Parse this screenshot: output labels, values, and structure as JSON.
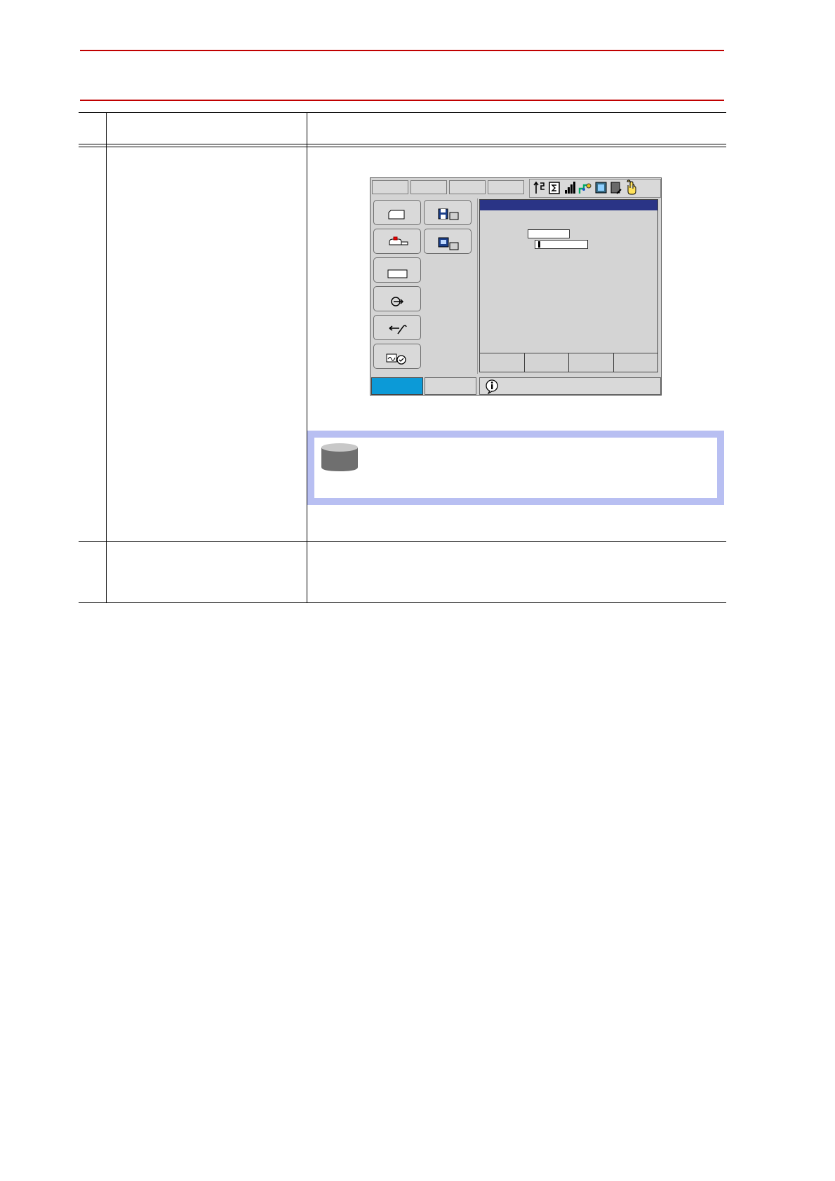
{
  "page": {
    "header_rule_color": "#c00000"
  },
  "table": {
    "column_headers": [
      "",
      "",
      ""
    ],
    "rows": [
      {
        "step": "",
        "operation": "",
        "explanation": ""
      },
      {
        "step": "",
        "operation": "",
        "explanation": ""
      }
    ]
  },
  "pendant": {
    "top_buttons": [
      "",
      "",
      "",
      ""
    ],
    "status_icons": [
      "arrows-icon",
      "sigma-icon",
      "signal-bars-icon",
      "robot-link-icon",
      "screen-icon",
      "edit-icon",
      "hand-icon"
    ],
    "menu_buttons": [
      {
        "name": "job-menu-button",
        "icon": "document-icon"
      },
      {
        "name": "file-menu-button",
        "icon": "floppy-disk-icon"
      },
      {
        "name": "robot-menu-button",
        "icon": "robot-icon"
      },
      {
        "name": "display-menu-button",
        "icon": "monitor-icon"
      },
      {
        "name": "variable-menu-button",
        "icon": "box-icon"
      },
      {
        "name": "in-out-menu-button",
        "icon": "io-icon"
      },
      {
        "name": "setup-menu-button",
        "icon": "wrench-icon"
      },
      {
        "name": "system-info-menu-button",
        "icon": "system-check-icon"
      }
    ],
    "window_title": "",
    "input_fields": [
      "",
      ""
    ],
    "window_buttons": [
      "",
      "",
      "",
      ""
    ],
    "status_bar": {
      "left": "",
      "middle": "",
      "message": ""
    },
    "colors": {
      "active_status": "#0c9ad7",
      "title_bar": "#2a3486",
      "background": "#d4d4d4"
    }
  },
  "note": {
    "icon": "cylinder-icon",
    "text": "",
    "border_color": "#b8bff2"
  }
}
